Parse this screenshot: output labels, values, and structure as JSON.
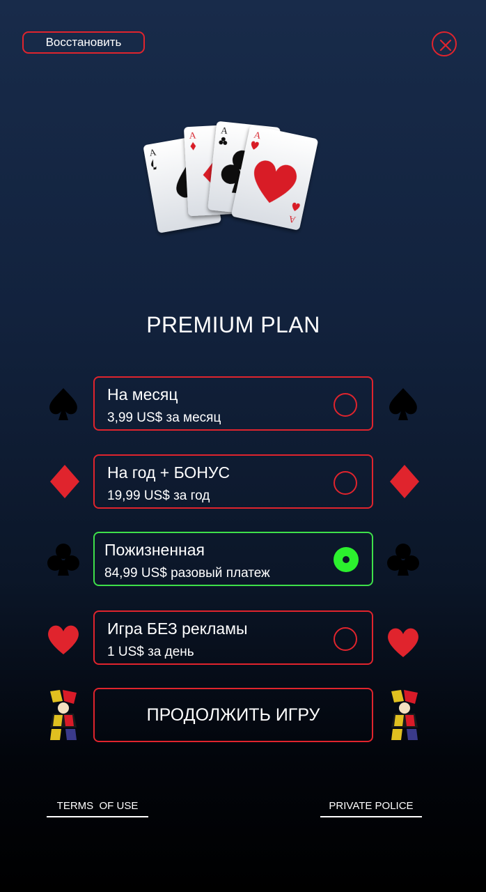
{
  "header": {
    "restore_label": "Восстановить"
  },
  "hero": {
    "cards": [
      {
        "rank": "A",
        "suit": "spade-icon"
      },
      {
        "rank": "A",
        "suit": "diamond-icon"
      },
      {
        "rank": "A",
        "suit": "club-icon"
      },
      {
        "rank": "A",
        "suit": "heart-icon"
      }
    ]
  },
  "title": "PREMIUM PLAN",
  "plans": [
    {
      "name": "На месяц",
      "price": "3,99 US$ за месяц",
      "selected": false,
      "suit": "spade-icon"
    },
    {
      "name": "На год + БОНУС",
      "price": "19,99 US$ за год",
      "selected": false,
      "suit": "diamond-icon"
    },
    {
      "name": "Пожизненная",
      "price": "84,99 US$ разовый платеж",
      "selected": true,
      "suit": "club-icon"
    },
    {
      "name": "Игра БЕЗ рекламы",
      "price": "1 US$ за день",
      "selected": false,
      "suit": "heart-icon"
    }
  ],
  "continue_label": "ПРОДОЛЖИТЬ ИГРУ",
  "footer": {
    "terms_label": "TERMS  OF USE",
    "privacy_label": "PRIVATE POLICE"
  },
  "colors": {
    "accent_red": "#e0242d",
    "selected_green": "#3ee04a",
    "radio_green": "#2cf02e",
    "background_top": "#182b4a",
    "background_bottom": "#000000"
  }
}
